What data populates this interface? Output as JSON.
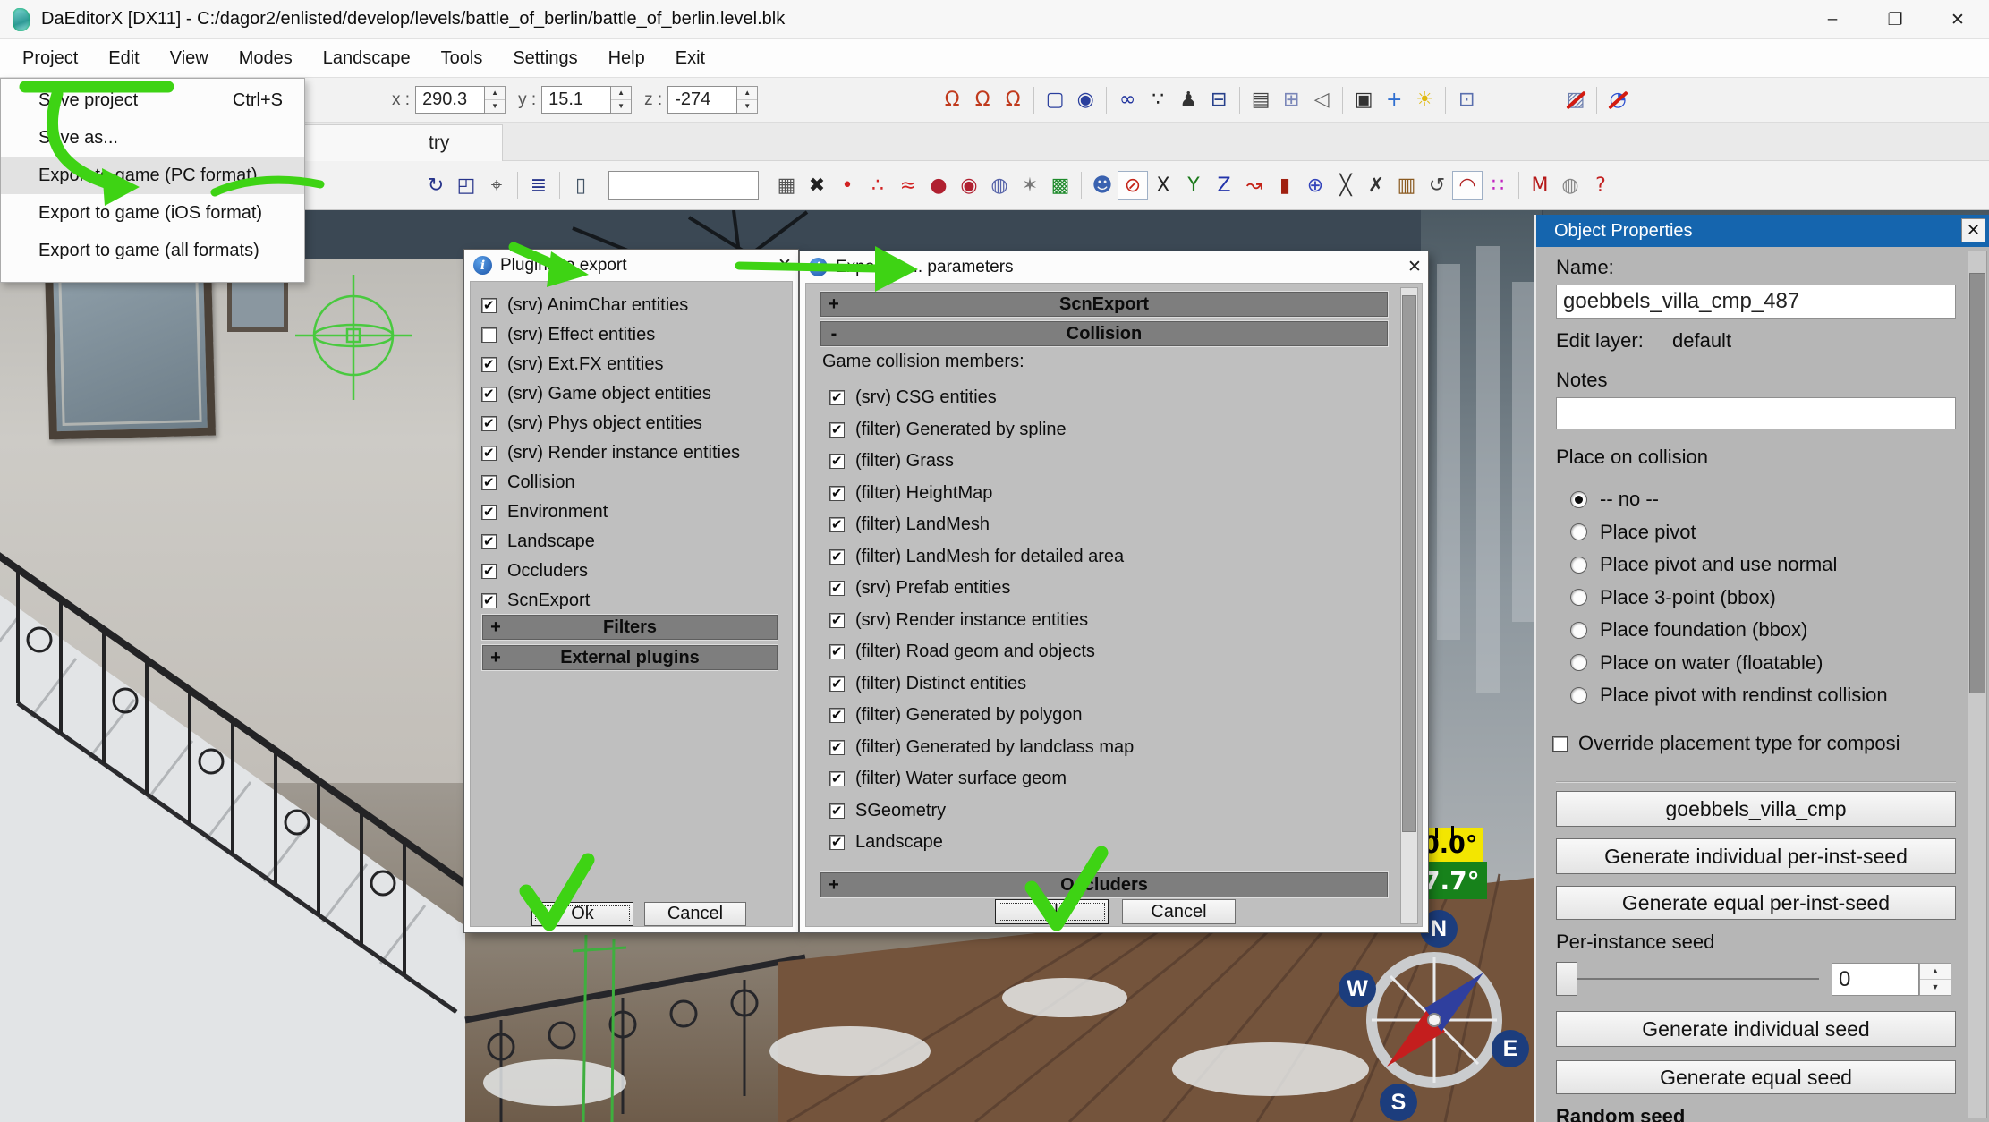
{
  "window": {
    "title": "DaEditorX  [DX11]  - C:/dagor2/enlisted/develop/levels/battle_of_berlin/battle_of_berlin.level.blk",
    "minimize": "–",
    "maximize": "❐",
    "close": "✕"
  },
  "menu": {
    "items": [
      "Project",
      "Edit",
      "View",
      "Modes",
      "Landscape",
      "Tools",
      "Settings",
      "Help",
      "Exit"
    ]
  },
  "project_menu": {
    "items": [
      {
        "label": "Save project",
        "shortcut": "Ctrl+S"
      },
      {
        "label": "Save as..."
      },
      {
        "label": "Export to game (PC format)",
        "highlight": true
      },
      {
        "label": "Export to game (iOS format)"
      },
      {
        "label": "Export to game (all formats)"
      }
    ]
  },
  "toolbar": {
    "x_label": "x :",
    "x_value": "290.3",
    "y_label": "y :",
    "y_value": "15.1",
    "z_label": "z :",
    "z_value": "-274",
    "icons": [
      {
        "name": "snap-move-magnet-icon",
        "glyph": "Ω",
        "color": "#c03a1d"
      },
      {
        "name": "snap-angle-magnet-icon",
        "glyph": "Ω",
        "color": "#c03a1d"
      },
      {
        "name": "snap-scale-magnet-icon",
        "glyph": "Ω",
        "color": "#c03a1d"
      },
      {
        "name": "toolbar-separator",
        "sep": true,
        "inter": "false"
      },
      {
        "name": "select-marquee-icon",
        "glyph": "▢",
        "color": "#2a3f9d"
      },
      {
        "name": "zoom-extents-icon",
        "glyph": "◉",
        "color": "#2a3f9d"
      },
      {
        "name": "toolbar-separator",
        "sep": true,
        "inter": "false"
      },
      {
        "name": "binoculars-icon",
        "glyph": "∞",
        "color": "#1c2f9c"
      },
      {
        "name": "footsteps-icon",
        "glyph": "∵",
        "color": "#222222"
      },
      {
        "name": "walk-mode-icon",
        "glyph": "♟",
        "color": "#333333"
      },
      {
        "name": "drive-mode-icon",
        "glyph": "⊟",
        "color": "#27408b"
      },
      {
        "name": "toolbar-separator",
        "sep": true,
        "inter": "false"
      },
      {
        "name": "stats-icon",
        "glyph": "▤",
        "color": "#444444"
      },
      {
        "name": "quad-view-icon",
        "glyph": "⊞",
        "color": "#7a86b8"
      },
      {
        "name": "view-cone-icon",
        "glyph": "◁",
        "color": "#666666"
      },
      {
        "name": "toolbar-separator",
        "sep": true,
        "inter": "false"
      },
      {
        "name": "screenshot-camera-icon",
        "glyph": "▣",
        "color": "#333333"
      },
      {
        "name": "camera-position-icon",
        "glyph": "+",
        "color": "#2f6fd0"
      },
      {
        "name": "sun-light-icon",
        "glyph": "☀",
        "color": "#e0b90f"
      },
      {
        "name": "toolbar-separator",
        "sep": true,
        "inter": "false"
      },
      {
        "name": "console-window-icon",
        "glyph": "⊡",
        "color": "#5a6fae"
      },
      {
        "name": "toolbar-gap",
        "gap": true,
        "inter": "false"
      },
      {
        "name": "hide-textures-icon",
        "glyph": "▨",
        "color": "#6d7fae",
        "slash": true
      },
      {
        "name": "toolbar-separator",
        "sep": true,
        "inter": "false"
      },
      {
        "name": "disable-navigation-icon",
        "glyph": "◔",
        "color": "#2b4fd0",
        "slash": true
      }
    ]
  },
  "tab_strip": {
    "active_tab": "try"
  },
  "toolbar2": {
    "filter_value": "",
    "left_icons": [
      {
        "name": "rotate-mode-icon",
        "glyph": "↻",
        "color": "#27348b"
      },
      {
        "name": "scale-mode-icon",
        "glyph": "◰",
        "color": "#27348b"
      },
      {
        "name": "drop-on-ground-icon",
        "glyph": "⌖",
        "color": "#555555"
      },
      {
        "name": "toolbar-separator",
        "sep": true,
        "inter": "false"
      },
      {
        "name": "select-by-name-icon",
        "glyph": "≣",
        "color": "#27348b"
      },
      {
        "name": "toolbar-separator",
        "sep": true,
        "inter": "false"
      },
      {
        "name": "object-props-icon",
        "glyph": "▯",
        "color": "#445566"
      }
    ],
    "right_icons": [
      {
        "name": "compound-outliner-icon",
        "glyph": "▦",
        "color": "#555555"
      },
      {
        "name": "delete-objects-icon",
        "glyph": "✖",
        "color": "#222222"
      },
      {
        "name": "flag-dot-icon",
        "glyph": "•",
        "color": "#d22222",
        "inter": "false"
      },
      {
        "name": "scatter-points-icon",
        "glyph": "∴",
        "color": "#d22222"
      },
      {
        "name": "spline-draw-icon",
        "glyph": "≈",
        "color": "#d22222"
      },
      {
        "name": "sphere-entity-icon",
        "glyph": "●",
        "color": "#b02030"
      },
      {
        "name": "sphere-search-icon",
        "glyph": "◉",
        "color": "#b02030"
      },
      {
        "name": "sphere-copy-icon",
        "glyph": "◍",
        "color": "#5562a8"
      },
      {
        "name": "magic-wand-icon",
        "glyph": "✶",
        "color": "#777777"
      },
      {
        "name": "selection-region-icon",
        "glyph": "▩",
        "color": "#1d8a2a"
      },
      {
        "name": "toolbar-separator",
        "sep": true,
        "inter": "false"
      },
      {
        "name": "sphere-face-icon",
        "glyph": "☻",
        "color": "#3a62b0"
      },
      {
        "name": "collision-off-icon",
        "glyph": "⊘",
        "color": "#c42318",
        "active": true
      },
      {
        "name": "axis-x-icon",
        "glyph": "X",
        "color": "#222222"
      },
      {
        "name": "axis-y-icon",
        "glyph": "Y",
        "color": "#1c7a1c"
      },
      {
        "name": "axis-z-icon",
        "glyph": "Z",
        "color": "#2233aa"
      },
      {
        "name": "curve-tool-icon",
        "glyph": "↝",
        "color": "#c42318"
      },
      {
        "name": "hydrant-icon",
        "glyph": "▮",
        "color": "#a02010"
      },
      {
        "name": "globe-icon",
        "glyph": "⊕",
        "color": "#3344bb"
      },
      {
        "name": "split-spline-icon",
        "glyph": "╳",
        "color": "#333333"
      },
      {
        "name": "cut-spline-icon",
        "glyph": "✗",
        "color": "#333333"
      },
      {
        "name": "crate-icon",
        "glyph": "▥",
        "color": "#8a5a20"
      },
      {
        "name": "refresh-loop-icon",
        "glyph": "↺",
        "color": "#444444"
      },
      {
        "name": "curve-edit-icon",
        "glyph": "◠",
        "color": "#b02020",
        "active": true
      },
      {
        "name": "scatter-magenta-icon",
        "glyph": "∷",
        "color": "#c026c0"
      },
      {
        "name": "toolbar-separator",
        "sep": true,
        "inter": "false"
      },
      {
        "name": "material-icon",
        "glyph": "M",
        "color": "#b51818"
      },
      {
        "name": "golfball-icon",
        "glyph": "◍",
        "color": "#888888"
      },
      {
        "name": "help-icon",
        "glyph": "?",
        "color": "#c32222"
      }
    ]
  },
  "plugins_dialog": {
    "title": "Plugins to export",
    "icon": "i",
    "close": "✕",
    "items": [
      {
        "label": "(srv) AnimChar entities",
        "checked": true
      },
      {
        "label": "(srv) Effect entities",
        "checked": false
      },
      {
        "label": "(srv) Ext.FX entities",
        "checked": true
      },
      {
        "label": "(srv) Game object entities",
        "checked": true
      },
      {
        "label": "(srv) Phys object entities",
        "checked": true
      },
      {
        "label": "(srv) Render instance entities",
        "checked": true
      },
      {
        "label": "Collision",
        "checked": true
      },
      {
        "label": "Environment",
        "checked": true
      },
      {
        "label": "Landscape",
        "checked": true
      },
      {
        "label": "Occluders",
        "checked": true
      },
      {
        "label": "ScnExport",
        "checked": true
      }
    ],
    "groups": [
      {
        "plus": "+",
        "label": "Filters"
      },
      {
        "plus": "+",
        "label": "External plugins"
      }
    ],
    "ok": "Ok",
    "cancel": "Cancel"
  },
  "export_dialog": {
    "title": "Export to ... parameters",
    "icon": "i",
    "close": "✕",
    "scn_plus": "+",
    "scn_label": "ScnExport",
    "col_minus": "-",
    "col_label": "Collision",
    "members_label": "Game collision members:",
    "items": [
      {
        "label": "(srv) CSG entities",
        "checked": true
      },
      {
        "label": "(filter) Generated by spline",
        "checked": true
      },
      {
        "label": "(filter) Grass",
        "checked": true
      },
      {
        "label": "(filter) HeightMap",
        "checked": true
      },
      {
        "label": "(filter) LandMesh",
        "checked": true
      },
      {
        "label": "(filter) LandMesh for detailed area",
        "checked": true
      },
      {
        "label": "(srv) Prefab entities",
        "checked": true
      },
      {
        "label": "(srv) Render instance entities",
        "checked": true
      },
      {
        "label": "(filter) Road geom and objects",
        "checked": true
      },
      {
        "label": "(filter) Distinct entities",
        "checked": true
      },
      {
        "label": "(filter) Generated by polygon",
        "checked": true
      },
      {
        "label": "(filter) Generated by landclass map",
        "checked": true
      },
      {
        "label": "(filter) Water surface geom",
        "checked": true
      },
      {
        "label": "SGeometry",
        "checked": true
      },
      {
        "label": "Landscape",
        "checked": true
      }
    ],
    "occ_plus": "+",
    "occ_label": "Occluders",
    "ok": "Ok",
    "cancel": "Cancel"
  },
  "object_properties": {
    "title": "Object Properties",
    "close": "✕",
    "name_label": "Name:",
    "name_value": "goebbels_villa_cmp_487",
    "edit_layer_label": "Edit layer:",
    "edit_layer_value": "default",
    "notes_label": "Notes",
    "notes_value": "",
    "place_label": "Place on collision",
    "radios": [
      {
        "label": "-- no --",
        "selected": true
      },
      {
        "label": "Place pivot"
      },
      {
        "label": "Place pivot and use normal"
      },
      {
        "label": "Place 3-point (bbox)"
      },
      {
        "label": "Place foundation (bbox)"
      },
      {
        "label": "Place on water (floatable)"
      },
      {
        "label": "Place pivot with rendinst collision"
      }
    ],
    "override_label": "Override placement type for composi",
    "asset_button": "goebbels_villa_cmp",
    "gen_individual_per_inst": "Generate individual per-inst-seed",
    "gen_equal_per_inst": "Generate equal per-inst-seed",
    "per_instance_seed_label": "Per-instance seed",
    "per_instance_seed_value": "0",
    "gen_individual_seed": "Generate individual seed",
    "gen_equal_seed": "Generate equal seed",
    "random_seed_label": "Random seed"
  },
  "viewport": {
    "angle_top": "0.0°",
    "angle_bottom": "7.7°",
    "compass": {
      "n": "N",
      "w": "W",
      "e": "E",
      "s": "S"
    }
  },
  "colors": {
    "annotation": "#3ed314",
    "panel_title": "#1565ae",
    "grp_header": "#7e7e7e",
    "angle_yellow": "#f3e600",
    "angle_green": "#17821b"
  }
}
